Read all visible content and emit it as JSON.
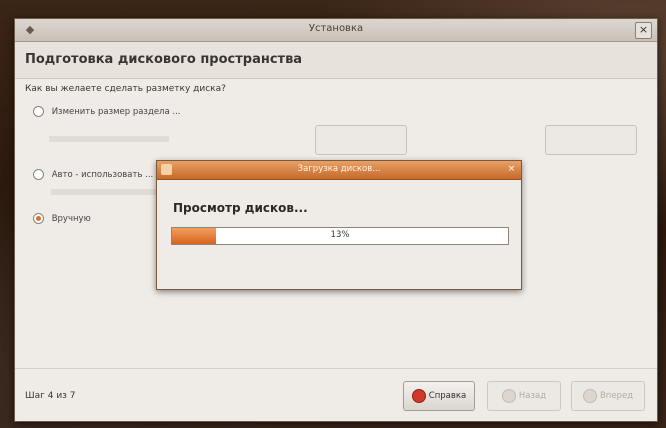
{
  "window": {
    "title": "Установка",
    "close_symbol": "×",
    "header": "Подготовка дискового пространства"
  },
  "question": "Как вы желаете сделать разметку диска?",
  "options": [
    {
      "label": "Изменить размер раздела ...",
      "checked": false
    },
    {
      "label": "Авто - использовать ...",
      "checked": false
    },
    {
      "label": "Вручную",
      "checked": true
    }
  ],
  "dialog": {
    "title": "Загрузка дисков...",
    "message": "Просмотр дисков...",
    "progress": 0.13,
    "progress_label": "13%"
  },
  "footer": {
    "step": "Шаг 4 из 7",
    "help": "Справка",
    "back": "Назад",
    "forward": "Вперед"
  },
  "colors": {
    "accent": "#d9621c",
    "title_accent": "#c66a2a"
  }
}
